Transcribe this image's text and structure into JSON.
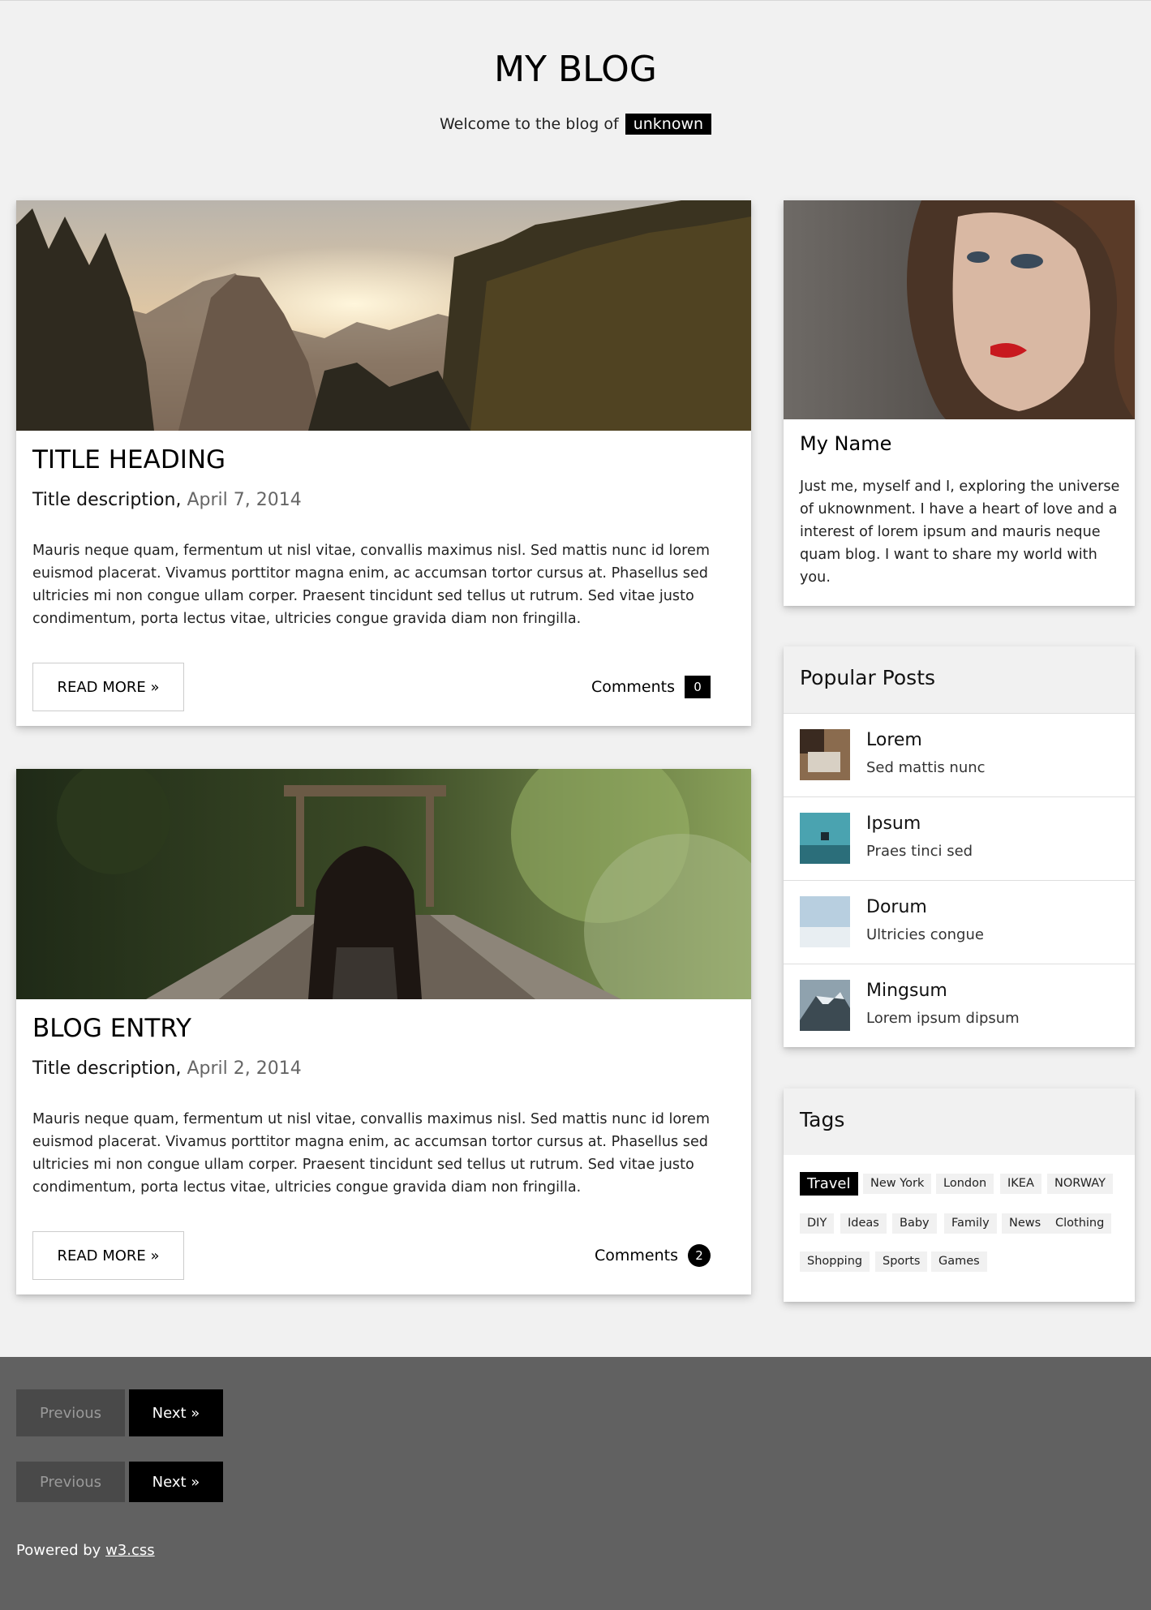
{
  "header": {
    "title": "MY BLOG",
    "welcome_text": "Welcome to the blog of",
    "owner": "unknown"
  },
  "posts": [
    {
      "title": "TITLE HEADING",
      "description": "Title description,",
      "date": "April 7, 2014",
      "body": "Mauris neque quam, fermentum ut nisl vitae, convallis maximus nisl. Sed mattis nunc id lorem euismod placerat. Vivamus porttitor magna enim, ac accumsan tortor cursus at. Phasellus sed ultricies mi non congue ullam corper. Praesent tincidunt sed tellus ut rutrum. Sed vitae justo condimentum, porta lectus vitae, ultricies congue gravida diam non fringilla.",
      "read_more": "READ MORE »",
      "comments_label": "Comments",
      "comments_count": "0"
    },
    {
      "title": "BLOG ENTRY",
      "description": "Title description,",
      "date": "April 2, 2014",
      "body": "Mauris neque quam, fermentum ut nisl vitae, convallis maximus nisl. Sed mattis nunc id lorem euismod placerat. Vivamus porttitor magna enim, ac accumsan tortor cursus at. Phasellus sed ultricies mi non congue ullam corper. Praesent tincidunt sed tellus ut rutrum. Sed vitae justo condimentum, porta lectus vitae, ultricies congue gravida diam non fringilla.",
      "read_more": "READ MORE »",
      "comments_label": "Comments",
      "comments_count": "2"
    }
  ],
  "about": {
    "name": "My Name",
    "text": "Just me, myself and I, exploring the universe of uknownment. I have a heart of love and a interest of lorem ipsum and mauris neque quam blog. I want to share my world with you."
  },
  "popular": {
    "heading": "Popular Posts",
    "items": [
      {
        "title": "Lorem",
        "subtitle": "Sed mattis nunc"
      },
      {
        "title": "Ipsum",
        "subtitle": "Praes tinci sed"
      },
      {
        "title": "Dorum",
        "subtitle": "Ultricies congue"
      },
      {
        "title": "Mingsum",
        "subtitle": "Lorem ipsum dipsum"
      }
    ]
  },
  "tags": {
    "heading": "Tags",
    "items": [
      "Travel",
      "New York",
      "London",
      "IKEA",
      "NORWAY",
      "DIY",
      "Ideas",
      "Baby",
      "Family",
      "News",
      "Clothing",
      "Shopping",
      "Sports",
      "Games"
    ],
    "active": "Travel"
  },
  "footer": {
    "previous_label": "Previous",
    "next_label": "Next »",
    "powered_text": "Powered by",
    "powered_link": "w3.css"
  },
  "colors": {
    "page_bg": "#f1f1f1",
    "footer_bg": "#616161",
    "accent": "#000000"
  }
}
